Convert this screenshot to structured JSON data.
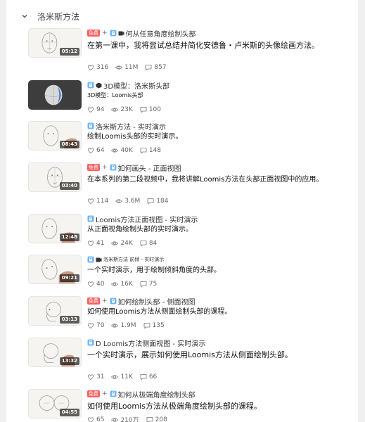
{
  "section": {
    "title": "洛米斯方法"
  },
  "items": [
    {
      "duration": "05:12",
      "badge": "免费",
      "title": "何从任意角度绘制头部",
      "desc": "在第一课中，我将尝试总结并简化安德鲁・卢米斯的头像绘画方法。",
      "likes": "316",
      "views": "11M",
      "comments": "857"
    },
    {
      "duration": "",
      "badge": "",
      "title": "3D模型：洛米斯头部",
      "desc": "3D模型：Loomis头部",
      "likes": "94",
      "views": "23K",
      "comments": "100"
    },
    {
      "duration": "08:43",
      "badge": "",
      "title": "洛米斯方法 - 实时演示",
      "desc": "绘制Loomis头部的实时演示。",
      "likes": "64",
      "views": "40K",
      "comments": "148"
    },
    {
      "duration": "03:40",
      "badge": "免费",
      "title": "如何画头 - 正面视图",
      "desc": "在本系列的第二段视频中，我将讲解Loomis方法在头部正面视图中的应用。",
      "likes": "114",
      "views": "3.6M",
      "comments": "184"
    },
    {
      "duration": "12:48",
      "badge": "",
      "title": "Loomis方法正面视图 - 实时演示",
      "desc": "从正面视角绘制头部的实时演示。",
      "likes": "41",
      "views": "24K",
      "comments": "84"
    },
    {
      "duration": "09:21",
      "badge": "",
      "title": "洛米斯方法 前倾 - 实时演示",
      "desc": "一个实时演示，用于绘制倾斜角度的头部。",
      "likes": "40",
      "views": "16K",
      "comments": "75"
    },
    {
      "duration": "03:13",
      "badge": "免费",
      "title": "如何绘制头部 - 侧面视图",
      "desc": "如何使用Loomis方法从侧面绘制头部的课程。",
      "likes": "70",
      "views": "1.9M",
      "comments": "135"
    },
    {
      "duration": "13:32",
      "badge": "",
      "title": "D Loomis方法侧面视图 - 实时演示",
      "desc": "一个实时演示，展示如何使用Loomis方法从侧面绘制头部。",
      "likes": "31",
      "views": "11K",
      "comments": "66"
    },
    {
      "duration": "04:55",
      "badge": "免费",
      "title": "如何从极端角度绘制头部",
      "desc": "如何使用Loomis方法从极端角度绘制头部的课程。",
      "likes": "65",
      "views": "210万",
      "comments": "208"
    }
  ]
}
